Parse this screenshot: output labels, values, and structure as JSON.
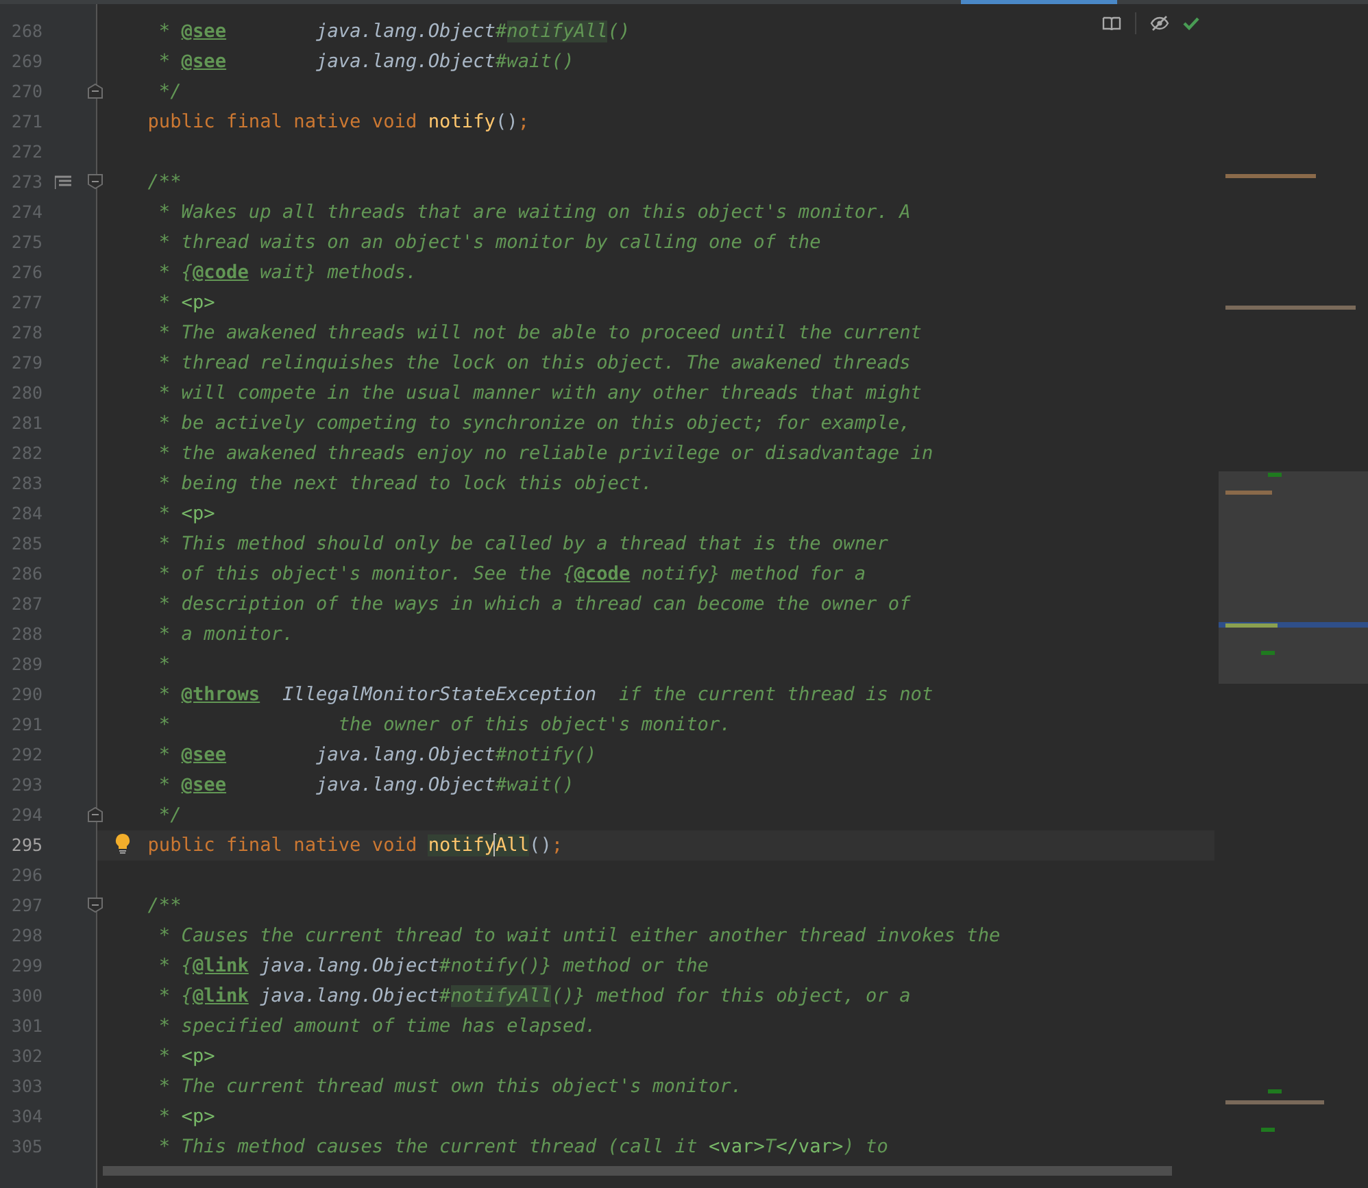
{
  "editor": {
    "lines": [
      {
        "number": "268",
        "tokens": [
          {
            "kind": "comment",
            "text": "     * "
          },
          {
            "kind": "tag",
            "text": "@see"
          },
          {
            "kind": "ref",
            "text": "        java.lang.Object"
          },
          {
            "kind": "comment",
            "text": "#"
          },
          {
            "kind": "comment",
            "text": "notifyAll",
            "highlight": true
          },
          {
            "kind": "comment",
            "text": "()"
          }
        ]
      },
      {
        "number": "269",
        "tokens": [
          {
            "kind": "comment",
            "text": "     * "
          },
          {
            "kind": "tag",
            "text": "@see"
          },
          {
            "kind": "ref",
            "text": "        java.lang.Object"
          },
          {
            "kind": "comment",
            "text": "#wait()"
          }
        ]
      },
      {
        "number": "270",
        "fold_end": true,
        "tokens": [
          {
            "kind": "comment",
            "text": "     */"
          }
        ]
      },
      {
        "number": "271",
        "tokens": [
          {
            "kind": "keyword",
            "text": "    public final native void "
          },
          {
            "kind": "method",
            "text": "notify"
          },
          {
            "kind": "punct",
            "text": "()"
          },
          {
            "kind": "keyword",
            "text": ";"
          }
        ]
      },
      {
        "number": "272"
      },
      {
        "number": "273",
        "fold_start": true,
        "doc_toggle": true,
        "tokens": [
          {
            "kind": "comment",
            "text": "    /**"
          }
        ]
      },
      {
        "number": "274",
        "tokens": [
          {
            "kind": "comment",
            "text": "     * Wakes up all threads that are waiting on this object's monitor. A"
          }
        ]
      },
      {
        "number": "275",
        "tokens": [
          {
            "kind": "comment",
            "text": "     * thread waits on an object's monitor by calling one of the"
          }
        ]
      },
      {
        "number": "276",
        "tokens": [
          {
            "kind": "comment",
            "text": "     * {"
          },
          {
            "kind": "tag",
            "text": "@code"
          },
          {
            "kind": "comment",
            "text": " wait} methods."
          }
        ]
      },
      {
        "number": "277",
        "tokens": [
          {
            "kind": "comment",
            "text": "     * "
          },
          {
            "kind": "html",
            "text": "<p>"
          }
        ]
      },
      {
        "number": "278",
        "tokens": [
          {
            "kind": "comment",
            "text": "     * The awakened threads will not be able to proceed until the current"
          }
        ]
      },
      {
        "number": "279",
        "tokens": [
          {
            "kind": "comment",
            "text": "     * thread relinquishes the lock on this object. The awakened threads"
          }
        ]
      },
      {
        "number": "280",
        "tokens": [
          {
            "kind": "comment",
            "text": "     * will compete in the usual manner with any other threads that might"
          }
        ]
      },
      {
        "number": "281",
        "tokens": [
          {
            "kind": "comment",
            "text": "     * be actively competing to synchronize on this object; for example,"
          }
        ]
      },
      {
        "number": "282",
        "tokens": [
          {
            "kind": "comment",
            "text": "     * the awakened threads enjoy no reliable privilege or disadvantage in"
          }
        ]
      },
      {
        "number": "283",
        "tokens": [
          {
            "kind": "comment",
            "text": "     * being the next thread to lock this object."
          }
        ]
      },
      {
        "number": "284",
        "tokens": [
          {
            "kind": "comment",
            "text": "     * "
          },
          {
            "kind": "html",
            "text": "<p>"
          }
        ]
      },
      {
        "number": "285",
        "tokens": [
          {
            "kind": "comment",
            "text": "     * This method should only be called by a thread that is the owner"
          }
        ]
      },
      {
        "number": "286",
        "tokens": [
          {
            "kind": "comment",
            "text": "     * of this object's monitor. See the {"
          },
          {
            "kind": "tag",
            "text": "@code"
          },
          {
            "kind": "comment",
            "text": " notify} method for a"
          }
        ]
      },
      {
        "number": "287",
        "tokens": [
          {
            "kind": "comment",
            "text": "     * description of the ways in which a thread can become the owner of"
          }
        ]
      },
      {
        "number": "288",
        "tokens": [
          {
            "kind": "comment",
            "text": "     * a monitor."
          }
        ]
      },
      {
        "number": "289",
        "tokens": [
          {
            "kind": "comment",
            "text": "     *"
          }
        ]
      },
      {
        "number": "290",
        "tokens": [
          {
            "kind": "comment",
            "text": "     * "
          },
          {
            "kind": "tag",
            "text": "@throws"
          },
          {
            "kind": "ref",
            "text": "  IllegalMonitorStateException"
          },
          {
            "kind": "comment",
            "text": "  if the current thread is not"
          }
        ]
      },
      {
        "number": "291",
        "tokens": [
          {
            "kind": "comment",
            "text": "     *               the owner of this object's monitor."
          }
        ]
      },
      {
        "number": "292",
        "tokens": [
          {
            "kind": "comment",
            "text": "     * "
          },
          {
            "kind": "tag",
            "text": "@see"
          },
          {
            "kind": "ref",
            "text": "        java.lang.Object"
          },
          {
            "kind": "comment",
            "text": "#notify()"
          }
        ]
      },
      {
        "number": "293",
        "tokens": [
          {
            "kind": "comment",
            "text": "     * "
          },
          {
            "kind": "tag",
            "text": "@see"
          },
          {
            "kind": "ref",
            "text": "        java.lang.Object"
          },
          {
            "kind": "comment",
            "text": "#wait()"
          }
        ]
      },
      {
        "number": "294",
        "fold_end": true,
        "tokens": [
          {
            "kind": "comment",
            "text": "     */"
          }
        ]
      },
      {
        "number": "295",
        "current": true,
        "intention_bulb": true,
        "tokens": [
          {
            "kind": "keyword",
            "text": "    public final native void "
          },
          {
            "kind": "method",
            "text": "notify",
            "highlight": true
          },
          {
            "kind": "method",
            "text": "All",
            "highlight": true,
            "caret_before": true
          },
          {
            "kind": "punct",
            "text": "()"
          },
          {
            "kind": "keyword",
            "text": ";"
          }
        ]
      },
      {
        "number": "296"
      },
      {
        "number": "297",
        "fold_start": true,
        "tokens": [
          {
            "kind": "comment",
            "text": "    /**"
          }
        ]
      },
      {
        "number": "298",
        "tokens": [
          {
            "kind": "comment",
            "text": "     * Causes the current thread to wait until either another thread invokes the"
          }
        ]
      },
      {
        "number": "299",
        "tokens": [
          {
            "kind": "comment",
            "text": "     * {"
          },
          {
            "kind": "tag",
            "text": "@link"
          },
          {
            "kind": "ref",
            "text": " java.lang.Object"
          },
          {
            "kind": "comment",
            "text": "#notify()} method or the"
          }
        ]
      },
      {
        "number": "300",
        "tokens": [
          {
            "kind": "comment",
            "text": "     * {"
          },
          {
            "kind": "tag",
            "text": "@link"
          },
          {
            "kind": "ref",
            "text": " java.lang.Object"
          },
          {
            "kind": "comment",
            "text": "#"
          },
          {
            "kind": "comment",
            "text": "notifyAll",
            "highlight": true
          },
          {
            "kind": "comment",
            "text": "()} method for this object, or a"
          }
        ]
      },
      {
        "number": "301",
        "tokens": [
          {
            "kind": "comment",
            "text": "     * specified amount of time has elapsed."
          }
        ]
      },
      {
        "number": "302",
        "tokens": [
          {
            "kind": "comment",
            "text": "     * "
          },
          {
            "kind": "html",
            "text": "<p>"
          }
        ]
      },
      {
        "number": "303",
        "tokens": [
          {
            "kind": "comment",
            "text": "     * The current thread must own this object's monitor."
          }
        ]
      },
      {
        "number": "304",
        "tokens": [
          {
            "kind": "comment",
            "text": "     * "
          },
          {
            "kind": "html",
            "text": "<p>"
          }
        ]
      },
      {
        "number": "305",
        "tokens": [
          {
            "kind": "comment",
            "text": "     * This method causes the current thread (call it "
          },
          {
            "kind": "html",
            "text": "<var>"
          },
          {
            "kind": "comment",
            "text": "T"
          },
          {
            "kind": "html",
            "text": "</var>"
          },
          {
            "kind": "comment",
            "text": ") to"
          }
        ]
      }
    ]
  }
}
